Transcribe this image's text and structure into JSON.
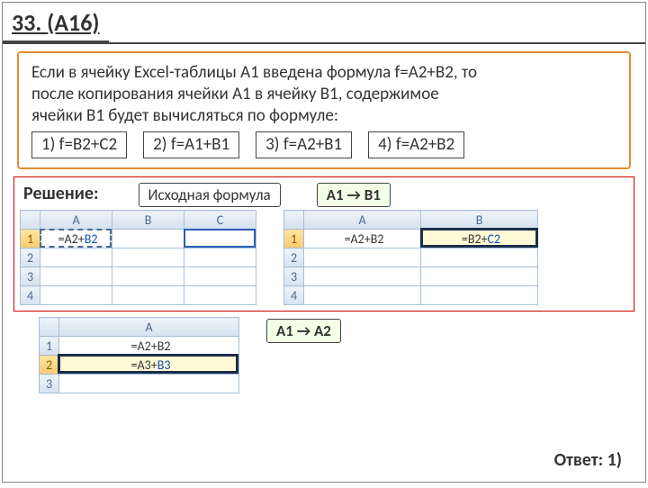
{
  "title": "33. (А16)",
  "task": {
    "line1": "Если в ячейку Excel-таблицы А1 введена формула f=A2+B2, то",
    "line2": "после копирования ячейки А1 в ячейку В1, содержимое",
    "line3": "ячейки В1 будет вычисляться по формуле:"
  },
  "options": {
    "o1": "1) f=B2+C2",
    "o2": "2) f=A1+B1",
    "o3": "3) f=A2+B1",
    "o4": "4) f=A2+B2"
  },
  "labels": {
    "solution": "Решение:",
    "source_formula": "Исходная формула",
    "a1b1_part1": "A1",
    "a1b1_part2": "B1",
    "a1a2_part1": "A1",
    "a1a2_part2": "A2"
  },
  "table_left": {
    "colA": "A",
    "colB": "B",
    "colC": "C",
    "r1": "1",
    "r2": "2",
    "r3": "3",
    "r4": "4",
    "cellA1_pref": "=A2+",
    "cellA1_suf": "B2"
  },
  "table_right": {
    "colA": "A",
    "colB": "B",
    "r1": "1",
    "r2": "2",
    "r3": "3",
    "r4": "4",
    "cellA1": "=A2+B2",
    "cellB1_pref": "=B2+",
    "cellB1_suf": "C2"
  },
  "table_bottom": {
    "colA": "A",
    "r1": "1",
    "r2": "2",
    "r3": "3",
    "cellA1": "=A2+B2",
    "cellA2_pref": "=A3+",
    "cellA2_suf": "B3"
  },
  "answer": "Ответ: 1)"
}
